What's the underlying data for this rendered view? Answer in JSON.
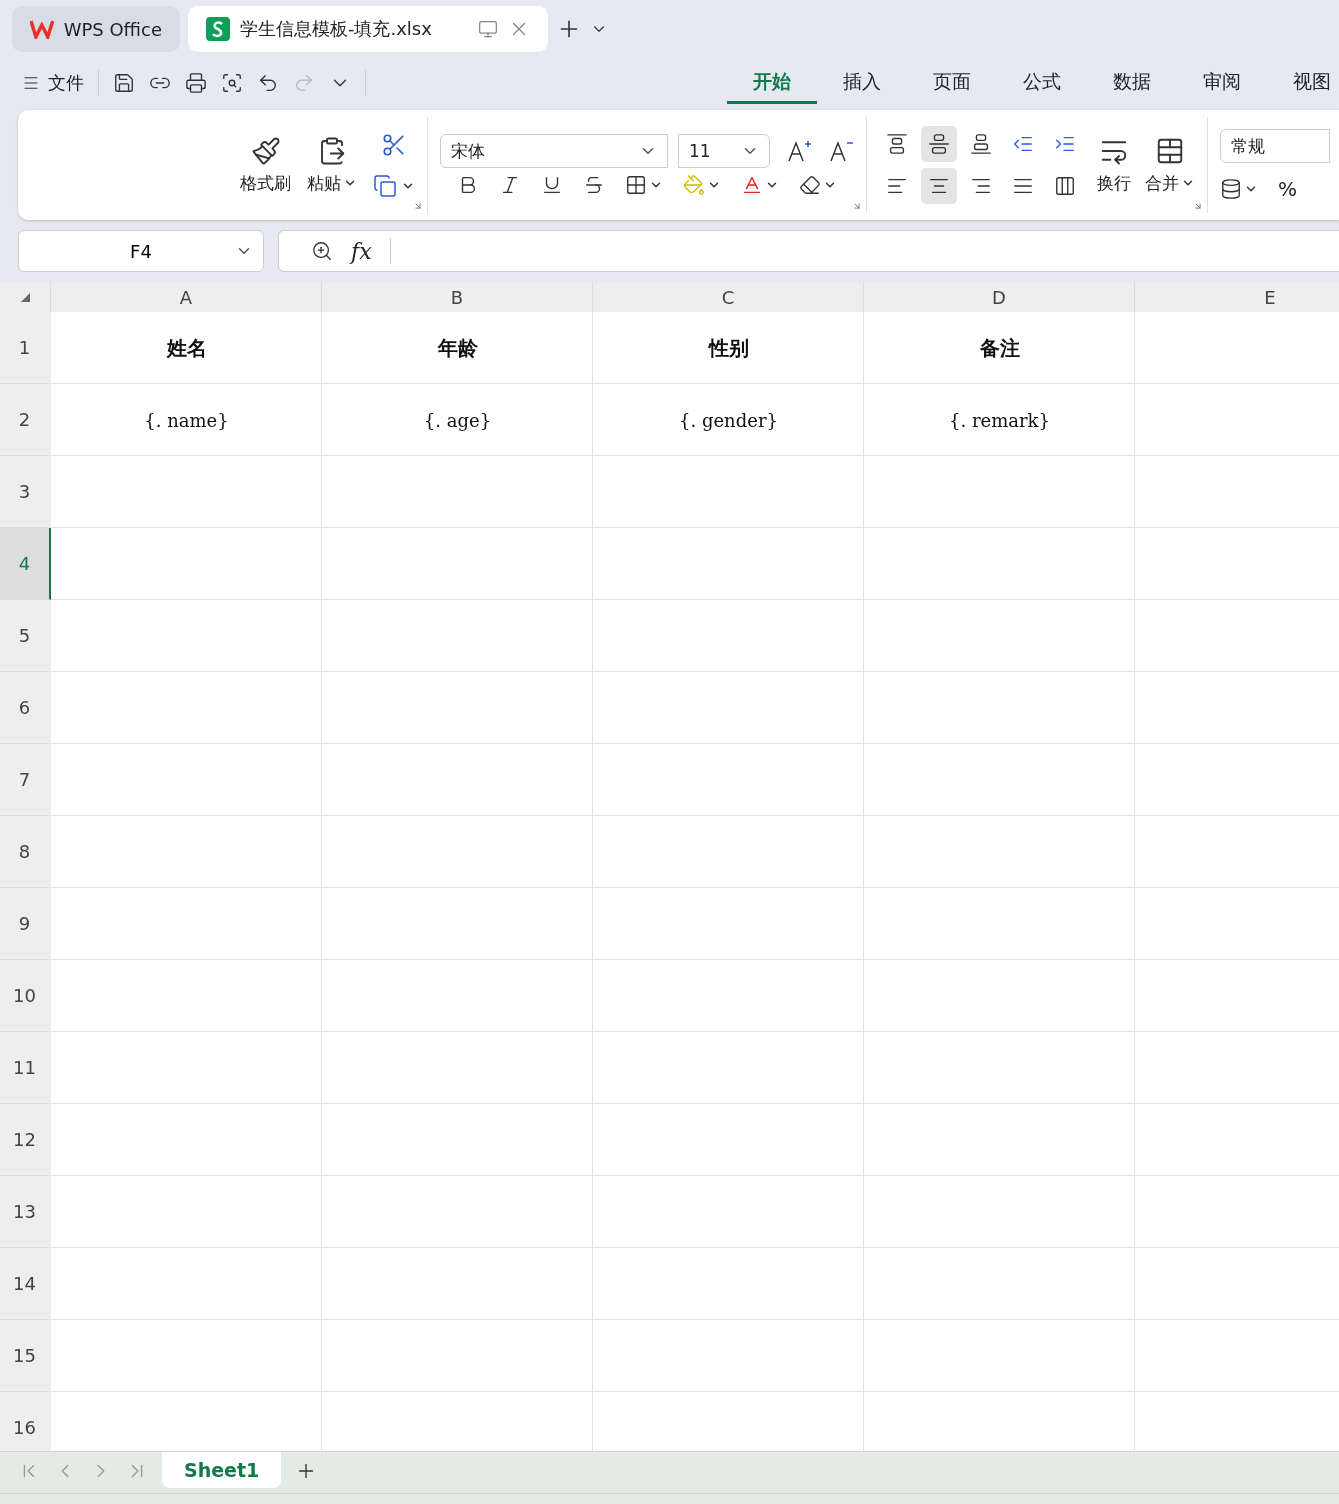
{
  "tabs": [
    {
      "kind": "home",
      "label": "WPS Office",
      "selected": false
    },
    {
      "kind": "sheet",
      "label": "学生信息模板-填充.xlsx",
      "selected": true
    }
  ],
  "file_menu": "文件",
  "ribbon_tabs": [
    {
      "label": "开始",
      "selected": true
    },
    {
      "label": "插入",
      "selected": false
    },
    {
      "label": "页面",
      "selected": false
    },
    {
      "label": "公式",
      "selected": false
    },
    {
      "label": "数据",
      "selected": false
    },
    {
      "label": "审阅",
      "selected": false
    },
    {
      "label": "视图",
      "selected": false
    }
  ],
  "ribbon": {
    "format_painter": "格式刷",
    "paste": "粘贴",
    "font_name": "宋体",
    "font_size": "11",
    "wrap": "换行",
    "merge": "合并",
    "number_format": "常规",
    "percent": "%"
  },
  "vertical_align": [
    {
      "kind": "top",
      "selected": false
    },
    {
      "kind": "middle",
      "selected": true
    },
    {
      "kind": "bottom",
      "selected": false
    }
  ],
  "horizontal_align": [
    {
      "kind": "left",
      "selected": false
    },
    {
      "kind": "center",
      "selected": true
    },
    {
      "kind": "right",
      "selected": false
    },
    {
      "kind": "justify",
      "selected": false
    },
    {
      "kind": "distributed",
      "selected": false
    }
  ],
  "name_box": "F4",
  "function_label": "fx",
  "columns": [
    "A",
    "B",
    "C",
    "D",
    "E"
  ],
  "rows": [
    {
      "label": "1",
      "selected": false,
      "cells": [
        {
          "kind": "header",
          "text": "姓名"
        },
        {
          "kind": "header",
          "text": "年龄"
        },
        {
          "kind": "header",
          "text": "性别"
        },
        {
          "kind": "header",
          "text": "备注"
        }
      ]
    },
    {
      "label": "2",
      "selected": false,
      "cells": [
        {
          "kind": "field",
          "text": "{. name}"
        },
        {
          "kind": "field",
          "text": "{. age}"
        },
        {
          "kind": "field",
          "text": "{. gender}"
        },
        {
          "kind": "field",
          "text": "{. remark}"
        }
      ]
    },
    {
      "label": "3",
      "selected": false
    },
    {
      "label": "4",
      "selected": true
    },
    {
      "label": "5",
      "selected": false
    },
    {
      "label": "6",
      "selected": false
    },
    {
      "label": "7",
      "selected": false
    },
    {
      "label": "8",
      "selected": false
    },
    {
      "label": "9",
      "selected": false
    },
    {
      "label": "10",
      "selected": false
    },
    {
      "label": "11",
      "selected": false
    },
    {
      "label": "12",
      "selected": false
    },
    {
      "label": "13",
      "selected": false
    },
    {
      "label": "14",
      "selected": false
    },
    {
      "label": "15",
      "selected": false
    },
    {
      "label": "16",
      "selected": false
    }
  ],
  "sheets": [
    {
      "label": "Sheet1",
      "selected": true
    }
  ]
}
